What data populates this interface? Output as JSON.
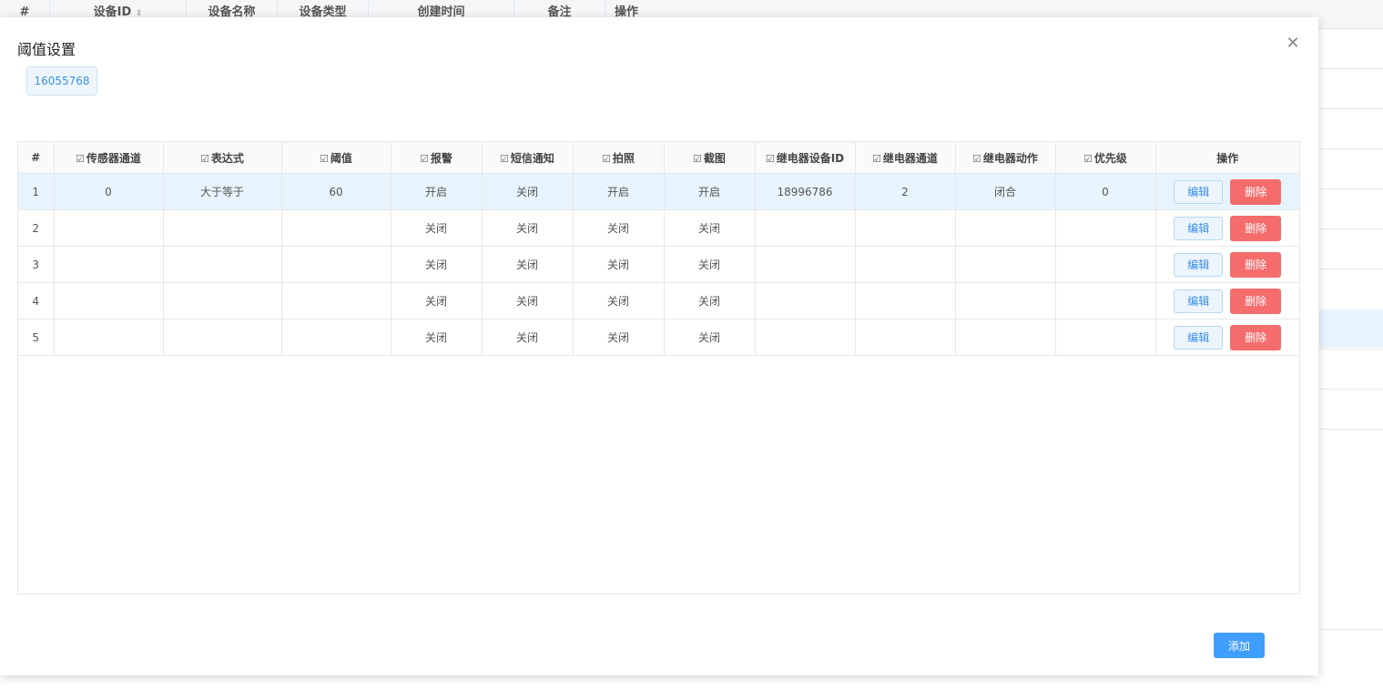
{
  "background_table": {
    "columns": [
      "#",
      "设备ID",
      "设备名称",
      "设备类型",
      "创建时间",
      "备注",
      "操作"
    ],
    "sort_icon": "sort-icon"
  },
  "modal": {
    "title": "阈值设置",
    "close_icon": "close-icon",
    "device_tag": "16055768",
    "edit_icon": "edit-icon",
    "columns": [
      "#",
      "传感器通道",
      "表达式",
      "阈值",
      "报警",
      "短信通知",
      "拍照",
      "截图",
      "继电器设备ID",
      "继电器通道",
      "继电器动作",
      "优先级",
      "操作"
    ],
    "rows": [
      {
        "num": "1",
        "channel": "0",
        "expr": "大于等于",
        "threshold": "60",
        "alarm": "开启",
        "sms": "关闭",
        "photo": "开启",
        "screenshot": "开启",
        "relay_id": "18996786",
        "relay_channel": "2",
        "relay_action": "闭合",
        "priority": "0"
      },
      {
        "num": "2",
        "channel": "",
        "expr": "",
        "threshold": "",
        "alarm": "关闭",
        "sms": "关闭",
        "photo": "关闭",
        "screenshot": "关闭",
        "relay_id": "",
        "relay_channel": "",
        "relay_action": "",
        "priority": ""
      },
      {
        "num": "3",
        "channel": "",
        "expr": "",
        "threshold": "",
        "alarm": "关闭",
        "sms": "关闭",
        "photo": "关闭",
        "screenshot": "关闭",
        "relay_id": "",
        "relay_channel": "",
        "relay_action": "",
        "priority": ""
      },
      {
        "num": "4",
        "channel": "",
        "expr": "",
        "threshold": "",
        "alarm": "关闭",
        "sms": "关闭",
        "photo": "关闭",
        "screenshot": "关闭",
        "relay_id": "",
        "relay_channel": "",
        "relay_action": "",
        "priority": ""
      },
      {
        "num": "5",
        "channel": "",
        "expr": "",
        "threshold": "",
        "alarm": "关闭",
        "sms": "关闭",
        "photo": "关闭",
        "screenshot": "关闭",
        "relay_id": "",
        "relay_channel": "",
        "relay_action": "",
        "priority": ""
      }
    ],
    "edit_label": "编辑",
    "delete_label": "删除",
    "add_label": "添加"
  },
  "colors": {
    "primary": "#409eff",
    "danger": "#f56c6c",
    "selected_row": "#e8f4fd"
  }
}
